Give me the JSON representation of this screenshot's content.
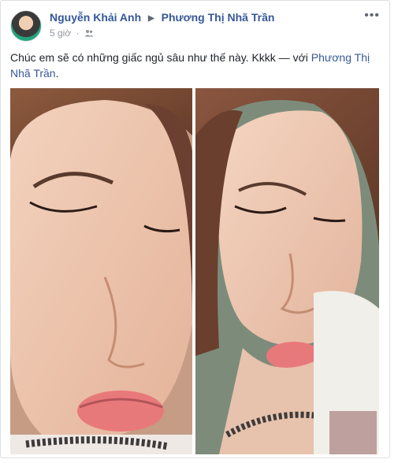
{
  "post": {
    "author": "Nguyễn Khải Anh",
    "target": "Phương Thị Nhã Trần",
    "time": "5 giờ",
    "audience_icon": "friends-icon",
    "more_icon": "more-options-icon",
    "caption_text": "Chúc em sẽ có những giấc ngủ sâu như thế này. Kkkk — với ",
    "caption_tag": "Phương Thị Nhã Trần",
    "caption_end": ".",
    "photos": [
      "photo-1",
      "photo-2"
    ]
  },
  "colors": {
    "link": "#365899",
    "meta": "#90949c",
    "text": "#1d2129"
  }
}
